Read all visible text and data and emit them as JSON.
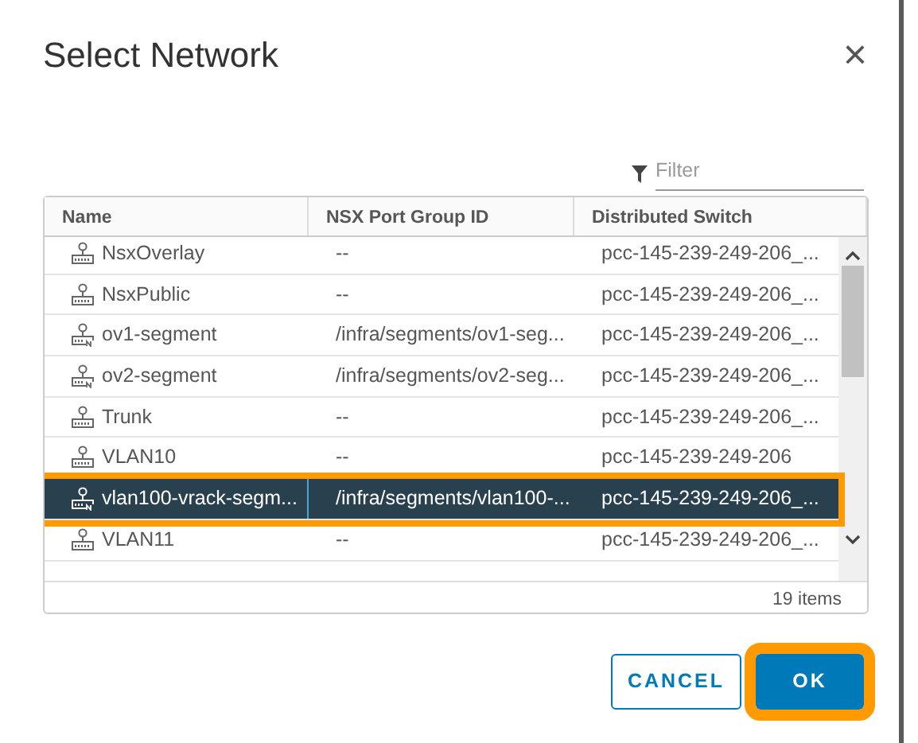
{
  "dialog": {
    "title": "Select Network",
    "close": "×"
  },
  "filter": {
    "placeholder": "Filter"
  },
  "table": {
    "columns": [
      "Name",
      "NSX Port Group ID",
      "Distributed Switch"
    ],
    "rows": [
      {
        "kind": "portgroup",
        "name": "NsxOverlay",
        "port_group_id": "--",
        "switch": "pcc-145-239-249-206_...",
        "selected": false,
        "highlighted": false
      },
      {
        "kind": "portgroup",
        "name": "NsxPublic",
        "port_group_id": "--",
        "switch": "pcc-145-239-249-206_...",
        "selected": false,
        "highlighted": false
      },
      {
        "kind": "segment",
        "name": "ov1-segment",
        "port_group_id": "/infra/segments/ov1-seg...",
        "switch": "pcc-145-239-249-206_...",
        "selected": false,
        "highlighted": false
      },
      {
        "kind": "segment",
        "name": "ov2-segment",
        "port_group_id": "/infra/segments/ov2-seg...",
        "switch": "pcc-145-239-249-206_...",
        "selected": false,
        "highlighted": false
      },
      {
        "kind": "portgroup",
        "name": "Trunk",
        "port_group_id": "--",
        "switch": "pcc-145-239-249-206_...",
        "selected": false,
        "highlighted": false
      },
      {
        "kind": "portgroup",
        "name": "VLAN10",
        "port_group_id": "--",
        "switch": "pcc-145-239-249-206",
        "selected": false,
        "highlighted": false
      },
      {
        "kind": "segment",
        "name": "vlan100-vrack-segm...",
        "port_group_id": "/infra/segments/vlan100-...",
        "switch": "pcc-145-239-249-206_...",
        "selected": true,
        "highlighted": true
      },
      {
        "kind": "portgroup",
        "name": "VLAN11",
        "port_group_id": "--",
        "switch": "pcc-145-239-249-206_...",
        "selected": false,
        "highlighted": false
      }
    ],
    "footer": "19 items"
  },
  "buttons": [
    {
      "kind": "outline",
      "label": "CANCEL",
      "highlighted": false
    },
    {
      "kind": "primary",
      "label": "OK",
      "highlighted": true
    }
  ]
}
